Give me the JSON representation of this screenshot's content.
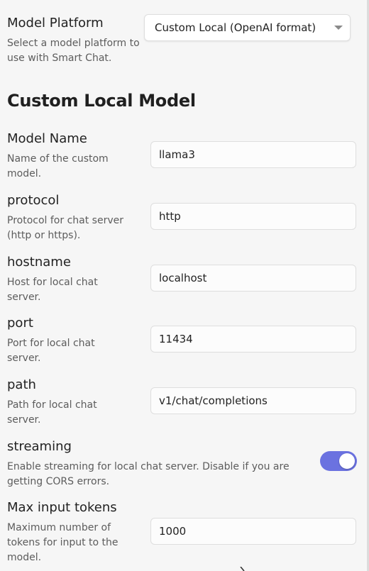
{
  "model_platform": {
    "name": "Model Platform",
    "description": "Select a model platform to use with Smart Chat.",
    "selected": "Custom Local (OpenAI format)"
  },
  "section_title": "Custom Local Model",
  "settings": {
    "model_name": {
      "name": "Model Name",
      "description": "Name of the custom model.",
      "value": "llama3"
    },
    "protocol": {
      "name": "protocol",
      "description": "Protocol for chat server (http or https).",
      "value": "http"
    },
    "hostname": {
      "name": "hostname",
      "description": "Host for local chat server.",
      "value": "localhost"
    },
    "port": {
      "name": "port",
      "description": "Port for local chat server.",
      "value": "11434"
    },
    "path": {
      "name": "path",
      "description": "Path for local chat server.",
      "value": "v1/chat/completions"
    },
    "streaming": {
      "name": "streaming",
      "description": "Enable streaming for local chat server. Disable if you are getting CORS errors.",
      "enabled": true
    },
    "max_input_tokens": {
      "name": "Max input tokens",
      "description": "Maximum number of tokens for input to the model.",
      "value": "1000"
    }
  },
  "colors": {
    "accent": "#6b72e0",
    "background": "#f6f6f6"
  }
}
